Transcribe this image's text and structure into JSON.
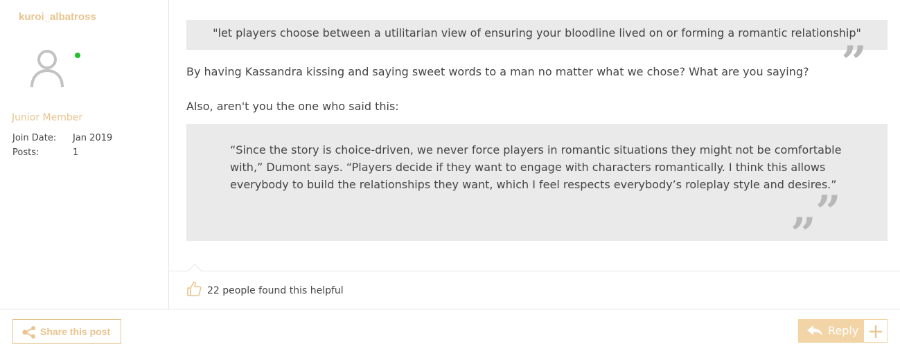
{
  "user": {
    "name": "kuroi_albatross",
    "rank": "Junior Member",
    "join_date_label": "Join Date:",
    "join_date_value": "Jan 2019",
    "posts_label": "Posts:",
    "posts_value": "1",
    "online": true
  },
  "post": {
    "quote1": "\"let players choose between a utilitarian view of ensuring your bloodline lived on or forming a romantic relationship\"",
    "paragraph1": "By having Kassandra kissing and saying sweet words to a man no matter what we chose? What are you saying?",
    "paragraph2": "Also, aren't you the one who said this:",
    "quote2": "“Since the story is choice-driven, we never force players in romantic situations they might not be comfortable with,” Dumont says. “Players decide if they want to engage with characters romantically. I think this allows everybody to build the relationships they want, which I feel respects everybody’s roleplay style and desires.”",
    "quote_mark": "”"
  },
  "helpful": {
    "text": "22 people found this helpful"
  },
  "actions": {
    "share_label": "Share this post",
    "reply_label": "Reply"
  },
  "colors": {
    "accent": "#e8c48e",
    "reply_bg": "#f2d4a7",
    "quote_bg": "#ebeaea",
    "online": "#22c02b"
  },
  "icons": {
    "avatar": "user-avatar-icon",
    "thumb": "thumbs-up-icon",
    "share": "share-icon",
    "reply": "reply-arrow-icon",
    "plus": "plus-icon"
  }
}
